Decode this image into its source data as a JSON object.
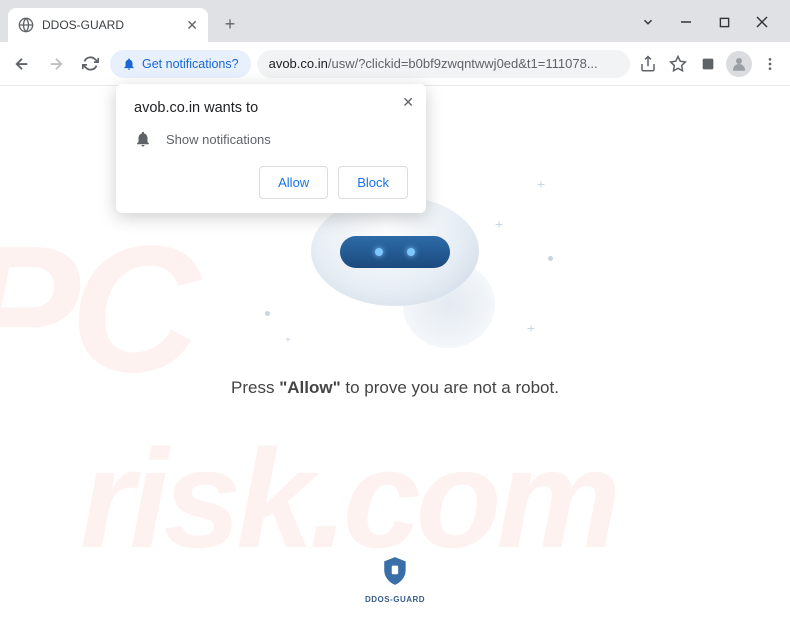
{
  "window": {
    "tab_title": "DDOS-GUARD",
    "notif_chip_label": "Get notifications?",
    "url_domain": "avob.co.in",
    "url_path": "/usw/?clickid=b0bf9zwqntwwj0ed&t1=111078..."
  },
  "notification": {
    "site": "avob.co.in",
    "wants_to": " wants to",
    "permission_label": "Show notifications",
    "allow_label": "Allow",
    "block_label": "Block"
  },
  "page": {
    "prompt_pre": "Press ",
    "prompt_bold": "\"Allow\"",
    "prompt_post": " to prove you are not a robot.",
    "brand": "DDOS-GUARD"
  },
  "watermark": {
    "wm1": "PC",
    "wm2": "risk.com"
  }
}
